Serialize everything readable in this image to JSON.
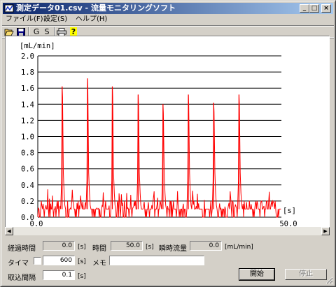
{
  "window": {
    "title": "測定データ01.csv - 流量モニタリングソフト",
    "minimize_glyph": "_",
    "maximize_glyph": "□",
    "close_glyph": "×"
  },
  "menu": [
    {
      "label": "ファイル(F)"
    },
    {
      "label": "設定(S)"
    },
    {
      "label": "ヘルプ(H)"
    }
  ],
  "toolbar": {
    "open_icon": "open-folder-icon",
    "save_icon": "save-disk-icon",
    "g_label": "G",
    "s_label": "S",
    "print_icon": "printer-icon",
    "help_label": "?"
  },
  "chart_data": {
    "type": "line",
    "ylabel": "[mL/min]",
    "xlabel": "[s]",
    "ylim": [
      0,
      2.0
    ],
    "xlim": [
      0,
      50.0
    ],
    "y_ticks": [
      "2.0",
      "1.8",
      "1.6",
      "1.4",
      "1.2",
      "1.0",
      "0.8",
      "0.6",
      "0.4",
      "0.2",
      "0.0"
    ],
    "x_ticks": [
      "0.0",
      "50.0"
    ],
    "grid": true,
    "color": "#ff0000",
    "peaks": [
      {
        "x": 5.0,
        "y": 1.62
      },
      {
        "x": 10.2,
        "y": 1.72
      },
      {
        "x": 15.3,
        "y": 1.62
      },
      {
        "x": 20.6,
        "y": 1.52
      },
      {
        "x": 25.7,
        "y": 1.4
      },
      {
        "x": 30.9,
        "y": 1.52
      },
      {
        "x": 36.1,
        "y": 1.42
      },
      {
        "x": 41.3,
        "y": 1.52
      }
    ]
  },
  "status": {
    "elapsed_label": "経過時間",
    "elapsed_value": "0.0",
    "elapsed_unit": "[s]",
    "time_label": "時間",
    "time_value": "50.0",
    "time_unit": "[s]",
    "flow_label": "瞬時流量",
    "flow_value": "0.0",
    "flow_unit": "[mL/min]",
    "timer_label": "タイマ",
    "timer_checked": false,
    "timer_value": "600",
    "timer_unit": "[s]",
    "memo_label": "メモ",
    "memo_value": "",
    "interval_label": "取込間隔",
    "interval_value": "0.1",
    "interval_unit": "[s]",
    "start_label": "開始",
    "stop_label": "停止"
  }
}
